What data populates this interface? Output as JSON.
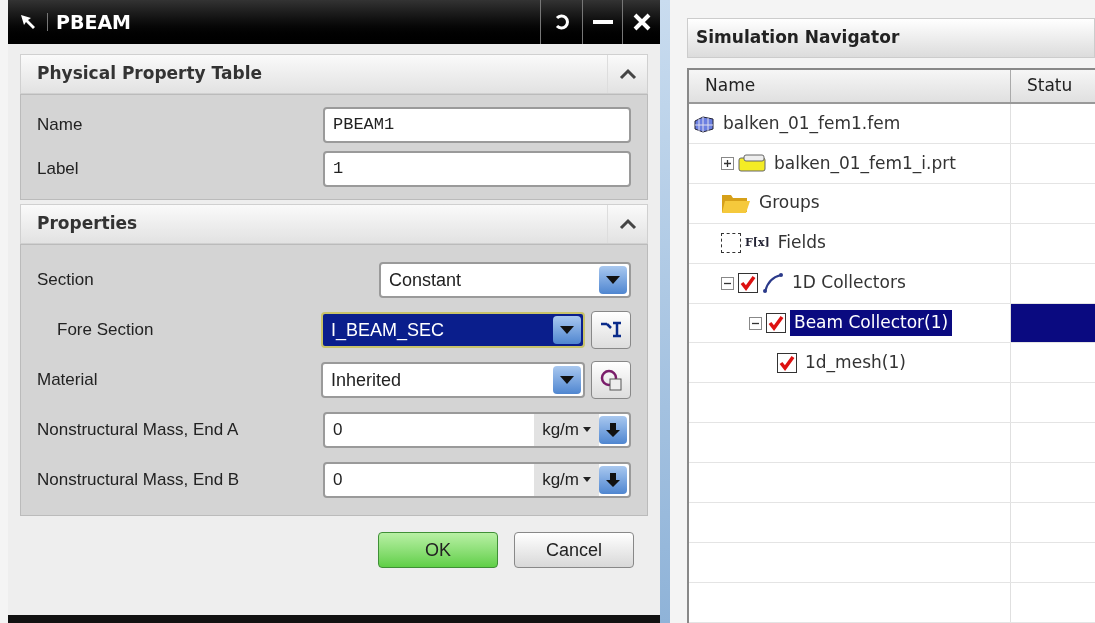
{
  "dialog": {
    "title": "PBEAM",
    "sections": [
      {
        "title": "Physical Property Table",
        "expanded": true,
        "fields": [
          {
            "kind": "text",
            "label": "Name",
            "value": "PBEAM1",
            "indented": false,
            "highlighted": false
          },
          {
            "kind": "text",
            "label": "Label",
            "value": "1",
            "indented": false,
            "highlighted": false
          }
        ]
      },
      {
        "title": "Properties",
        "expanded": true,
        "fields": [
          {
            "kind": "select",
            "label": "Section",
            "value": "Constant",
            "indented": false,
            "highlighted": false
          },
          {
            "kind": "select",
            "label": "Fore Section",
            "value": "I_BEAM_SEC",
            "indented": true,
            "highlighted": true,
            "tool": {
              "kind": "section"
            }
          },
          {
            "kind": "select",
            "label": "Material",
            "value": "Inherited",
            "indented": false,
            "highlighted": false,
            "tool": {
              "kind": "material"
            }
          },
          {
            "kind": "unit",
            "label": "Nonstructural Mass, End A",
            "value": "0",
            "unit": "kg/m",
            "indented": false,
            "highlighted": false
          },
          {
            "kind": "unit",
            "label": "Nonstructural Mass, End B",
            "value": "0",
            "unit": "kg/m",
            "indented": false,
            "highlighted": false
          }
        ]
      }
    ],
    "buttons": [
      {
        "label": "OK",
        "default": true
      },
      {
        "label": "Cancel",
        "default": false
      }
    ]
  },
  "navigator": {
    "title": "Simulation Navigator",
    "columns": [
      "Name",
      "Statu"
    ],
    "tree": [
      {
        "label": "balken_01_fem1.fem",
        "kind": "fem",
        "selected": false,
        "children": [
          {
            "label": "balken_01_fem1_i.prt",
            "kind": "part",
            "expanded": false,
            "selected": false
          },
          {
            "label": "Groups",
            "kind": "folder",
            "selected": false
          },
          {
            "label": "Fields",
            "kind": "fields",
            "icon_label": "F[x]",
            "checked": false,
            "selected": false
          },
          {
            "label": "1D Collectors",
            "kind": "collector",
            "checked": true,
            "expanded": true,
            "selected": false,
            "children": [
              {
                "label": "Beam Collector(1)",
                "checked": true,
                "expanded": true,
                "selected": true,
                "children": [
                  {
                    "label": "1d_mesh(1)",
                    "checked": true,
                    "selected": false
                  }
                ]
              }
            ]
          }
        ]
      }
    ]
  }
}
